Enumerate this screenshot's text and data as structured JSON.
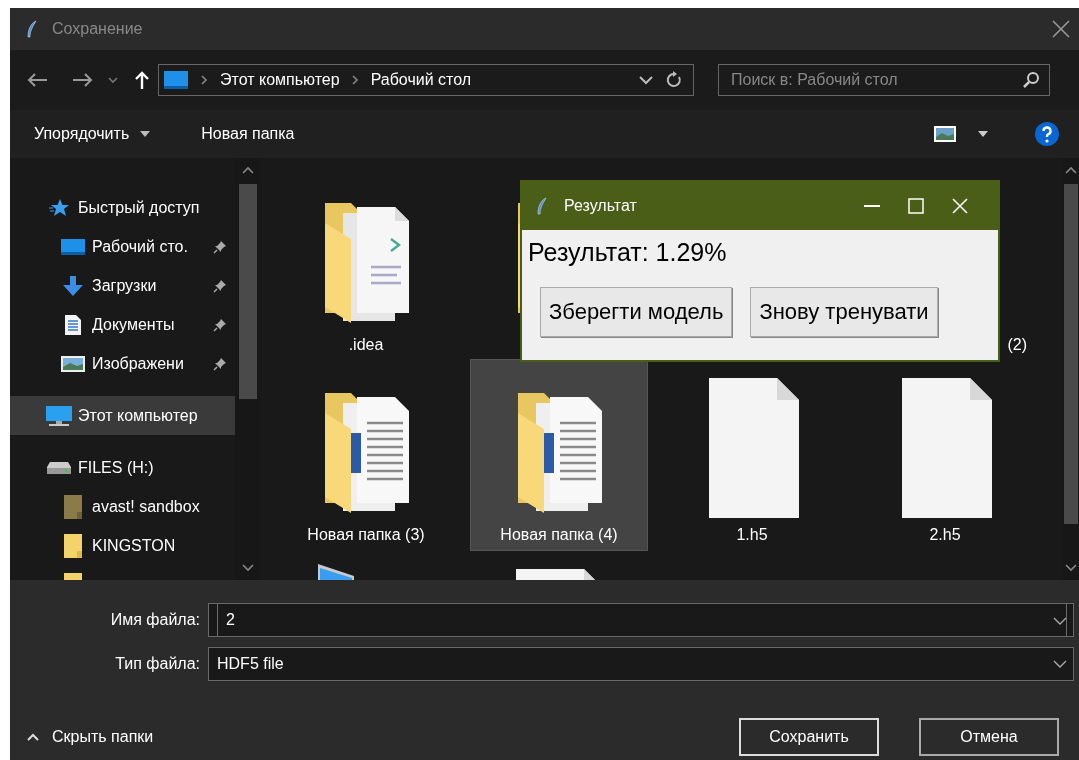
{
  "window": {
    "title": "Сохранение"
  },
  "address_bar": {
    "path": [
      "Этот компьютер",
      "Рабочий стол"
    ]
  },
  "search": {
    "placeholder": "Поиск в: Рабочий стол"
  },
  "toolbar": {
    "organize": "Упорядочить",
    "new_folder": "Новая папка"
  },
  "sidebar": {
    "items": [
      {
        "label": "Быстрый доступ",
        "kind": "star",
        "selected": false,
        "children": [
          {
            "label": "Рабочий сто.",
            "kind": "desktop",
            "pinned": true,
            "selected": false
          },
          {
            "label": "Загрузки",
            "kind": "download",
            "pinned": true,
            "selected": false
          },
          {
            "label": "Документы",
            "kind": "documents",
            "pinned": true,
            "selected": false
          },
          {
            "label": "Изображени",
            "kind": "pictures",
            "pinned": true,
            "selected": false
          }
        ]
      },
      {
        "label": "Этот компьютер",
        "kind": "computer",
        "selected": true
      },
      {
        "label": "FILES (H:)",
        "kind": "drive",
        "selected": false,
        "children": [
          {
            "label": "avast! sandbox",
            "kind": "sandbox-folder",
            "selected": false
          },
          {
            "label": "KINGSTON",
            "kind": "folder",
            "selected": false
          },
          {
            "kind": "folder"
          }
        ]
      }
    ]
  },
  "items": [
    {
      "label": ".idea",
      "kind": "folder-code",
      "selected": false
    },
    {
      "kind": "folder",
      "selected": false
    },
    {
      "label": "(2)",
      "kind": "partial",
      "selected": false
    },
    {
      "label": "Новая папка (3)",
      "kind": "folder-docs",
      "selected": false
    },
    {
      "label": "Новая папка (4)",
      "kind": "folder-docs",
      "selected": true
    },
    {
      "label": "1.h5",
      "kind": "file",
      "selected": false
    },
    {
      "label": "2.h5",
      "kind": "file",
      "selected": false
    },
    {
      "kind": "shortcut",
      "selected": false
    },
    {
      "kind": "file",
      "selected": false
    }
  ],
  "file_name": {
    "label": "Имя файла:",
    "value": "2"
  },
  "file_type": {
    "label": "Тип файла:",
    "value": "HDF5 file"
  },
  "hide_folders": "Скрыть папки",
  "buttons": [
    {
      "label": "Сохранить",
      "kind": "primary"
    },
    {
      "label": "Отмена",
      "kind": "normal"
    }
  ],
  "popup": {
    "title": "Результат",
    "message": "Результат: 1.29%",
    "buttons": [
      "Зберегти модель",
      "Знову тренувати"
    ]
  }
}
